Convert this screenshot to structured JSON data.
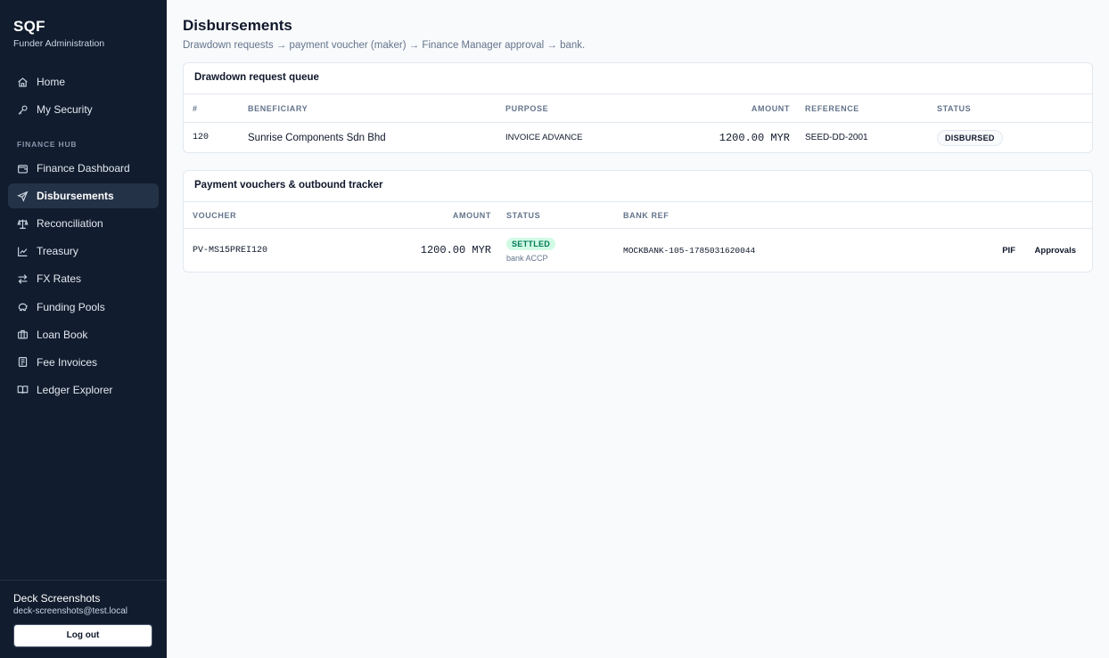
{
  "brand": {
    "name": "SQF",
    "subtitle": "Funder Administration"
  },
  "nav": {
    "top_items": [
      {
        "label": "Home",
        "icon": "home-icon"
      },
      {
        "label": "My Security",
        "icon": "key-icon"
      }
    ],
    "section_label": "FINANCE HUB",
    "finance_items": [
      {
        "label": "Finance Dashboard",
        "icon": "wallet-icon"
      },
      {
        "label": "Disbursements",
        "icon": "send-icon",
        "active": true
      },
      {
        "label": "Reconciliation",
        "icon": "scale-icon"
      },
      {
        "label": "Treasury",
        "icon": "chart-line-icon"
      },
      {
        "label": "FX Rates",
        "icon": "swap-arrows-icon"
      },
      {
        "label": "Funding Pools",
        "icon": "piggy-bank-icon"
      },
      {
        "label": "Loan Book",
        "icon": "briefcase-icon"
      },
      {
        "label": "Fee Invoices",
        "icon": "receipt-icon"
      },
      {
        "label": "Ledger Explorer",
        "icon": "book-open-icon"
      }
    ]
  },
  "user": {
    "name": "Deck Screenshots",
    "email": "deck-screenshots@test.local",
    "logout_label": "Log out"
  },
  "page": {
    "title": "Disbursements",
    "subtitle": "Drawdown requests → payment voucher (maker) → Finance Manager approval → bank."
  },
  "drawdown": {
    "title": "Drawdown request queue",
    "headers": {
      "num": "#",
      "beneficiary": "BENEFICIARY",
      "purpose": "PURPOSE",
      "amount": "AMOUNT",
      "reference": "REFERENCE",
      "status": "STATUS"
    },
    "rows": [
      {
        "num": "120",
        "beneficiary": "Sunrise Components Sdn Bhd",
        "purpose": "INVOICE ADVANCE",
        "amount": "1200.00 MYR",
        "reference": "SEED-DD-2001",
        "status": "DISBURSED"
      }
    ]
  },
  "vouchers": {
    "title": "Payment vouchers & outbound tracker",
    "headers": {
      "voucher": "VOUCHER",
      "amount": "AMOUNT",
      "status": "STATUS",
      "bank_ref": "BANK REF"
    },
    "rows": [
      {
        "voucher": "PV-MS15PREI120",
        "amount": "1200.00 MYR",
        "status": "SETTLED",
        "status_note": "bank ACCP",
        "bank_ref": "MOCKBANK-105-1785031620044",
        "action_pif": "PIF",
        "action_approvals": "Approvals"
      }
    ]
  },
  "colors": {
    "sidebar_bg": "#111c2e",
    "active_bg": "#243247",
    "settled_bg": "#d1fae5",
    "settled_text": "#047857"
  }
}
